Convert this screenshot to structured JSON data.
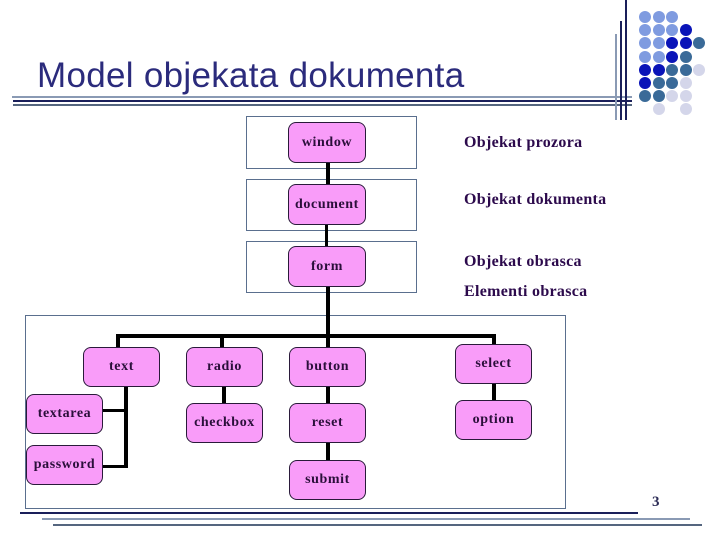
{
  "slide": {
    "title": "Model objekata dokumenta",
    "page_number": "3"
  },
  "colors": {
    "title": "#2b2b7c",
    "node_fill": "#f99cf9",
    "node_border": "#2a1a3a",
    "label_text": "#2c0a4c",
    "frame_border": "#5a6f8e",
    "dot_light_blue": "#7f9be0",
    "dot_dark_blue": "#0a14b8",
    "dot_steel": "#3a6a98",
    "dot_pale": "#d4d6ea"
  },
  "hierarchy": {
    "window": "window",
    "document": "document",
    "form": "form"
  },
  "descriptions": {
    "window": "Objekat prozora",
    "document": "Objekat dokumenta",
    "form": "Objekat obrasca",
    "elements": "Elementi obrasca"
  },
  "elements": {
    "text": "text",
    "textarea": "textarea",
    "password": "password",
    "radio": "radio",
    "checkbox": "checkbox",
    "button": "button",
    "reset": "reset",
    "submit": "submit",
    "select": "select",
    "option": "option"
  },
  "decoration": {
    "dot_grid": [
      [
        "light",
        "light",
        "light",
        "",
        ""
      ],
      [
        "light",
        "light",
        "light",
        "dark",
        ""
      ],
      [
        "light",
        "light",
        "dark",
        "dark",
        "steel"
      ],
      [
        "light",
        "light",
        "dark",
        "steel",
        ""
      ],
      [
        "dark",
        "dark",
        "steel",
        "steel",
        "pale"
      ],
      [
        "dark",
        "steel",
        "steel",
        "pale",
        ""
      ],
      [
        "steel",
        "steel",
        "pale",
        "pale",
        ""
      ],
      [
        "",
        "pale",
        "",
        "pale",
        ""
      ]
    ]
  }
}
